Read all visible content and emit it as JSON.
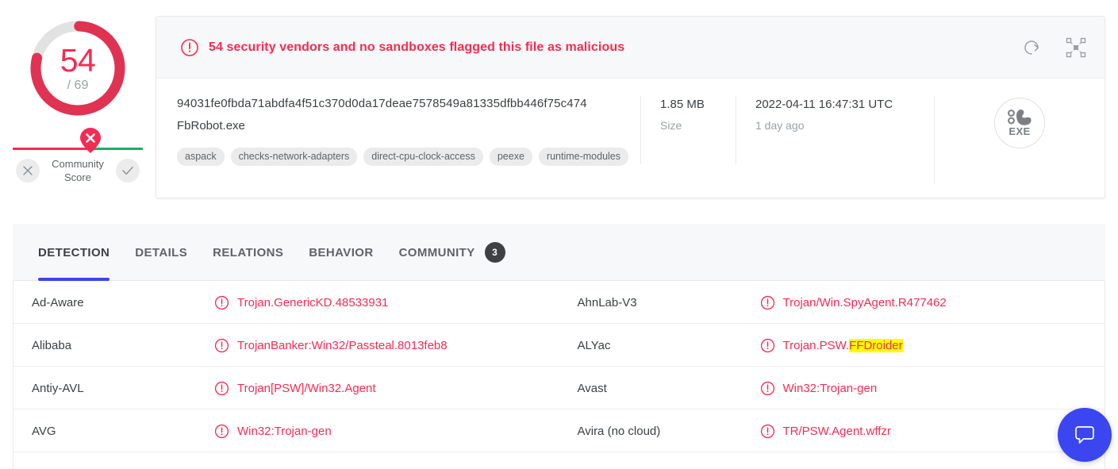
{
  "score": {
    "detections": "54",
    "total": "/ 69",
    "community_label_line1": "Community",
    "community_label_line2": "Score",
    "downvote_icon": "x-icon",
    "upvote_icon": "check-icon",
    "pin_icon": "x-marker-pin-icon",
    "gauge_color": "#f62b54",
    "gauge_track_color": "#e0e0e0",
    "bar_bad_color": "#f62b54",
    "bar_good_color": "#1faa6a"
  },
  "alert": {
    "icon": "alert-circle-icon",
    "message": "54 security vendors and no sandboxes flagged this file as malicious",
    "color": "#f62b54",
    "actions": [
      {
        "name": "reanalyze-icon",
        "label": "reanalyze"
      },
      {
        "name": "similar-graph-icon",
        "label": "similar"
      }
    ]
  },
  "file": {
    "hash": "94031fe0fbda71abdfa4f51c370d0da17deae7578549a81335dfbb446f75c474",
    "name": "FbRobot.exe",
    "tags": [
      "aspack",
      "checks-network-adapters",
      "direct-cpu-clock-access",
      "peexe",
      "runtime-modules"
    ],
    "size_value": "1.85 MB",
    "size_label": "Size",
    "date_value": "2022-04-11 16:47:31 UTC",
    "date_label": "1 day ago",
    "type_icon": "exe-file-icon",
    "type_label": "EXE"
  },
  "tabs": [
    {
      "label": "DETECTION",
      "active": true,
      "badge": null
    },
    {
      "label": "DETAILS",
      "active": false,
      "badge": null
    },
    {
      "label": "RELATIONS",
      "active": false,
      "badge": null
    },
    {
      "label": "BEHAVIOR",
      "active": false,
      "badge": null
    },
    {
      "label": "COMMUNITY",
      "active": false,
      "badge": "3"
    }
  ],
  "detections": [
    {
      "left": {
        "vendor": "Ad-Aware",
        "verdict": "Trojan.GenericKD.48533931",
        "icon": "alert-circle-icon",
        "highlight": ""
      },
      "right": {
        "vendor": "AhnLab-V3",
        "verdict": "Trojan/Win.SpyAgent.R477462",
        "icon": "alert-circle-icon",
        "highlight": ""
      }
    },
    {
      "left": {
        "vendor": "Alibaba",
        "verdict": "TrojanBanker:Win32/Passteal.8013feb8",
        "icon": "alert-circle-icon",
        "highlight": ""
      },
      "right": {
        "vendor": "ALYac",
        "verdict": "Trojan.PSW.",
        "icon": "alert-circle-icon",
        "highlight": "FFDroider"
      }
    },
    {
      "left": {
        "vendor": "Antiy-AVL",
        "verdict": "Trojan[PSW]/Win32.Agent",
        "icon": "alert-circle-icon",
        "highlight": ""
      },
      "right": {
        "vendor": "Avast",
        "verdict": "Win32:Trojan-gen",
        "icon": "alert-circle-icon",
        "highlight": ""
      }
    },
    {
      "left": {
        "vendor": "AVG",
        "verdict": "Win32:Trojan-gen",
        "icon": "alert-circle-icon",
        "highlight": ""
      },
      "right": {
        "vendor": "Avira (no cloud)",
        "verdict": "TR/PSW.Agent.wffzr",
        "icon": "alert-circle-icon",
        "highlight": ""
      }
    }
  ],
  "chat": {
    "icon": "chat-bubble-icon",
    "color": "#3b46f1"
  }
}
